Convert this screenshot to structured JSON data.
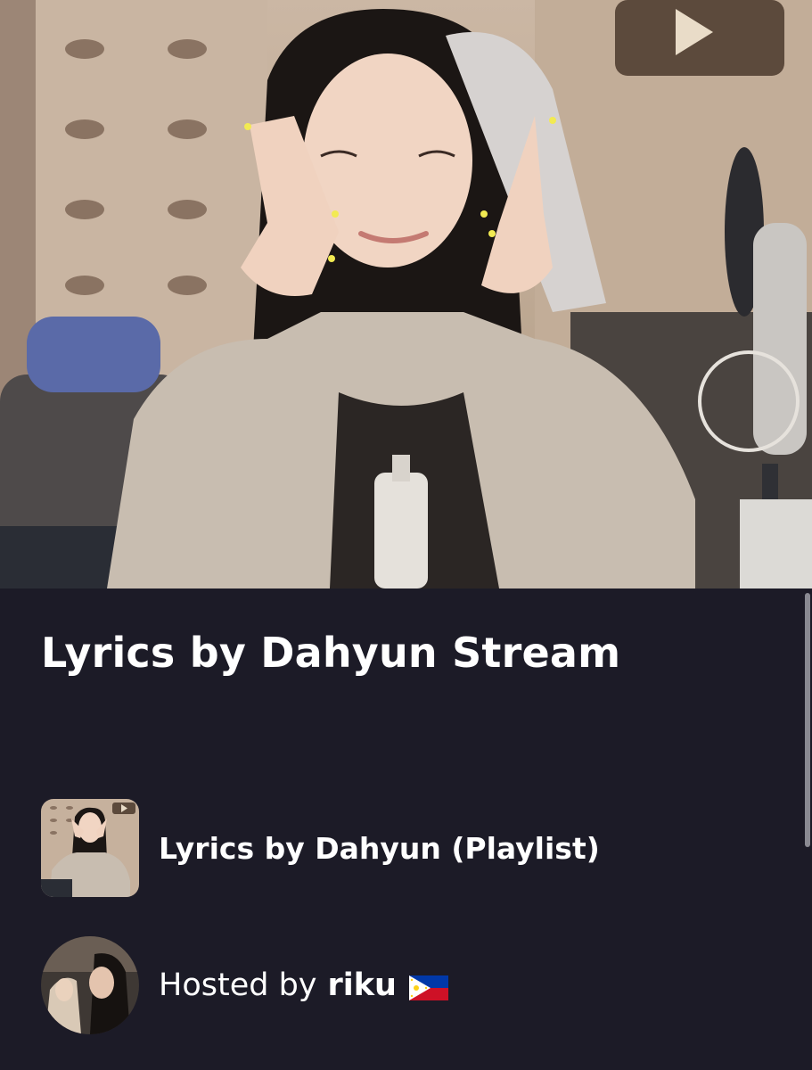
{
  "stream": {
    "title": "Lyrics by Dahyun Stream"
  },
  "playlist": {
    "label": "Lyrics by Dahyun (Playlist)",
    "thumbnail_icon": "playlist-cover-photo"
  },
  "host": {
    "prefix": "Hosted by",
    "name": "riku",
    "flag_icon": "philippines-flag-icon",
    "avatar_icon": "host-avatar-photo"
  },
  "colors": {
    "background": "#1c1b27",
    "text": "#ffffff"
  }
}
